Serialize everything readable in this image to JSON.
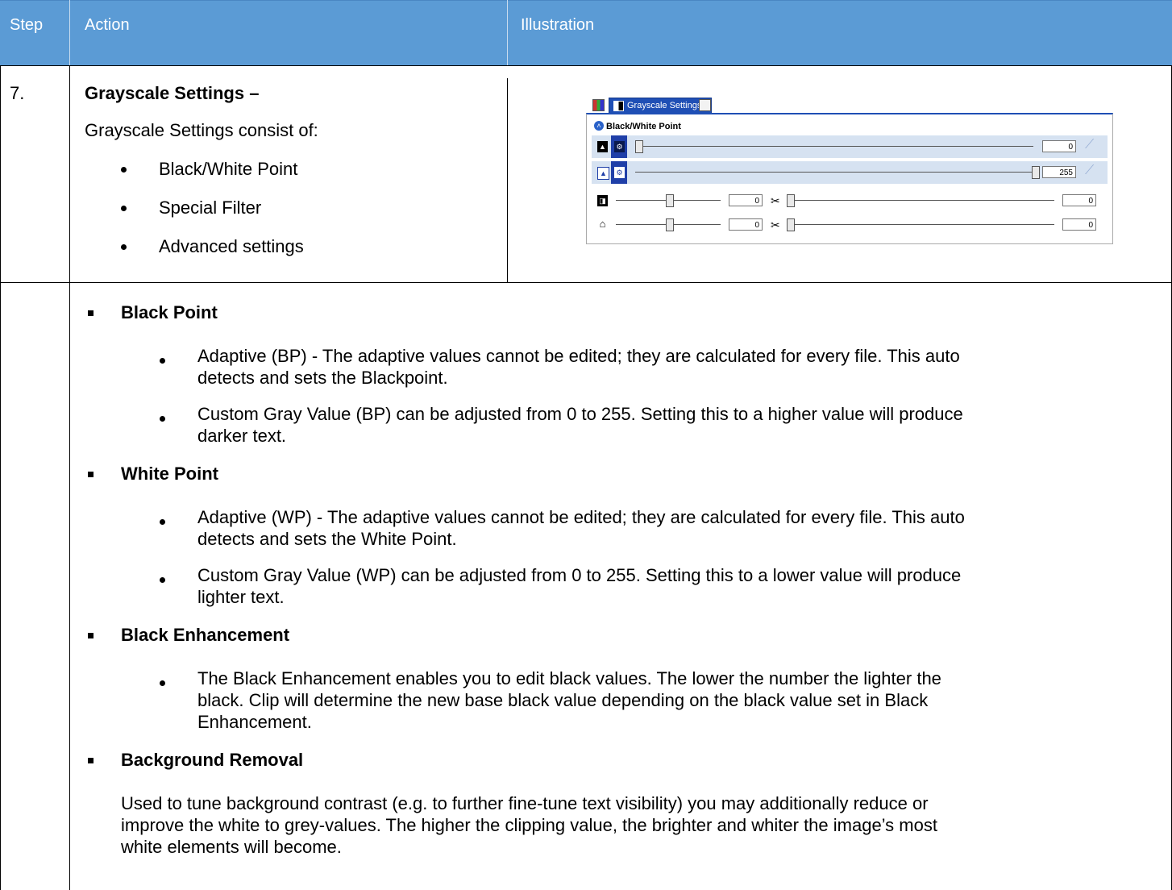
{
  "header": {
    "step": "Step",
    "action": "Action",
    "illustration": "Illustration"
  },
  "row1": {
    "step_number": "7.",
    "title": "Grayscale Settings –",
    "intro": "Grayscale Settings consist of:",
    "items": [
      "Black/White Point",
      "Special Filter",
      "Advanced settings"
    ]
  },
  "illustration": {
    "tab_label": "Grayscale Settings",
    "section_title": "Black/White Point",
    "black_point_value": "0",
    "white_point_value": "255",
    "enh_value": "0",
    "enh_clip_value": "0",
    "bg_value": "0",
    "bg_clip_value": "0"
  },
  "details": {
    "black_point": {
      "heading": "Black Point",
      "b1_l1": "Adaptive (BP) - The adaptive values cannot be edited; they are calculated for every file. This auto",
      "b1_l2": "detects and sets the Blackpoint.",
      "b2_l1": "Custom Gray Value (BP) can be adjusted from 0 to 255. Setting this to a higher value will produce",
      "b2_l2": "darker text."
    },
    "white_point": {
      "heading": "White Point",
      "b1_l1": "Adaptive (WP) - The adaptive values cannot be edited; they are calculated for every file. This auto",
      "b1_l2": "detects and sets the White Point.",
      "b2_l1": "Custom Gray Value (WP) can be adjusted from 0 to 255. Setting this to a lower value will produce",
      "b2_l2": "lighter text."
    },
    "black_enhancement": {
      "heading": "Black Enhancement",
      "b1_l1": "The Black Enhancement enables you to edit black values. The lower the number the lighter the",
      "b1_l2": "black. Clip will determine the new base black value depending on the black value set in Black",
      "b1_l3": "Enhancement."
    },
    "background_removal": {
      "heading": "Background Removal",
      "p_l1": "Used to tune background contrast (e.g. to further fine-tune text visibility) you may additionally reduce or",
      "p_l2": "improve the white to grey-values. The higher the clipping value, the brighter and whiter the image’s most",
      "p_l3": "white elements will become."
    }
  }
}
